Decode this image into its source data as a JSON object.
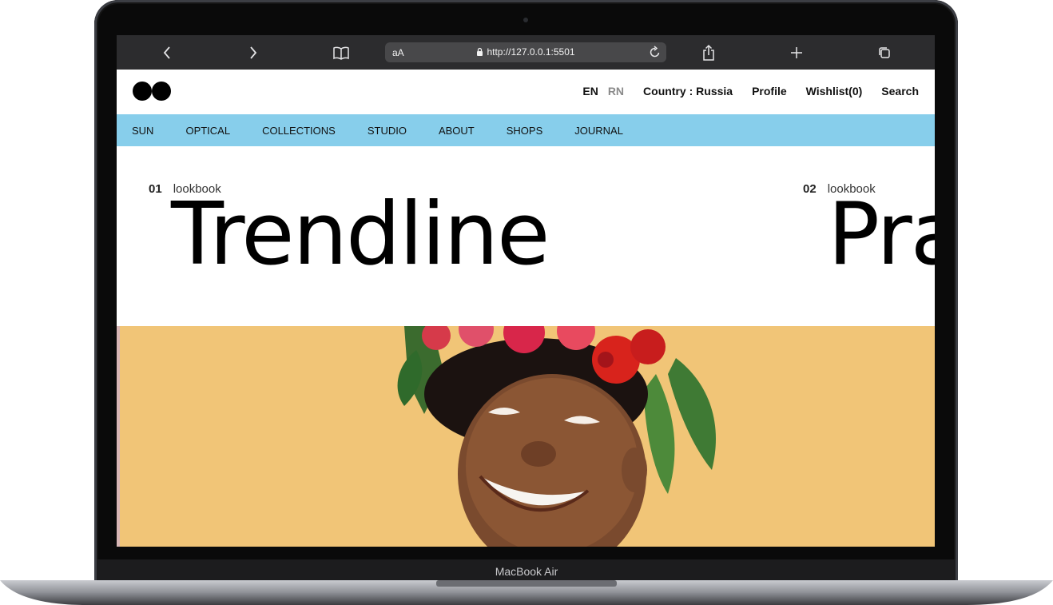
{
  "device": {
    "model_label": "MacBook Air"
  },
  "browser": {
    "back_icon": "chevron-left-icon",
    "forward_icon": "chevron-right-icon",
    "bookmarks_icon": "book-icon",
    "text_size_label": "aA",
    "url": "http://127.0.0.1:5501",
    "reload_icon": "reload-icon",
    "share_icon": "share-icon",
    "new_tab_icon": "plus-icon",
    "tabs_icon": "tabs-icon"
  },
  "header": {
    "logo": "two-circles-logo",
    "languages": [
      {
        "label": "EN",
        "active": true
      },
      {
        "label": "RN",
        "active": false
      }
    ],
    "country": "Country : Russia",
    "profile": "Profile",
    "wishlist": "Wishlist(0)",
    "search": "Search"
  },
  "nav": {
    "items": [
      "SUN",
      "OPTICAL",
      "COLLECTIONS",
      "STUDIO",
      "ABOUT",
      "SHOPS",
      "JOURNAL"
    ],
    "background": "#87ceeb"
  },
  "lookbooks": [
    {
      "number": "01",
      "label": "lookbook",
      "title": "Trendline"
    },
    {
      "number": "02",
      "label": "lookbook",
      "title": "Pra"
    }
  ],
  "hero": {
    "background": "#f1c577",
    "subject": "smiling woman with flower crown"
  }
}
